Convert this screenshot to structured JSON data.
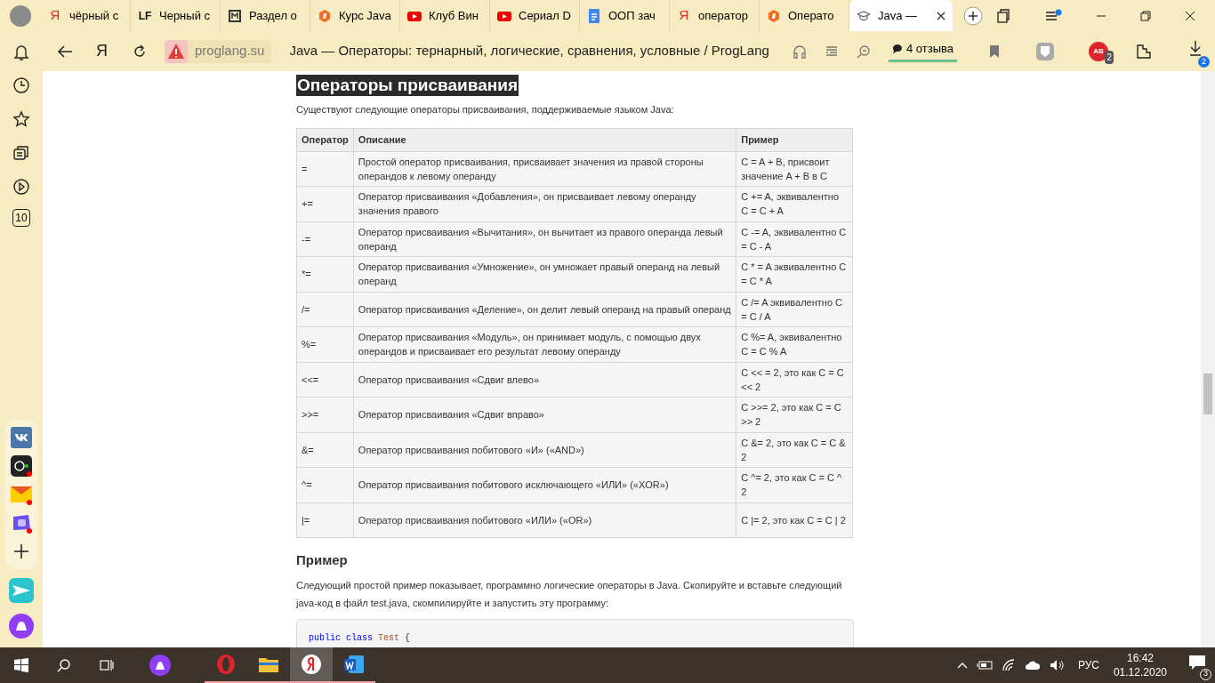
{
  "tabs": [
    {
      "kind": "letter",
      "logo": "Я",
      "title": "чёрный с",
      "selected": false
    },
    {
      "kind": "letter",
      "logo": "LF",
      "title": "Черный с",
      "selected": false
    },
    {
      "kind": "frame",
      "title": "Раздел о",
      "selected": false
    },
    {
      "kind": "hexagon",
      "title": "Курс Java",
      "selected": false
    },
    {
      "kind": "video",
      "title": "Клуб Вин",
      "selected": false
    },
    {
      "kind": "video",
      "title": "Сериал D",
      "selected": false
    },
    {
      "kind": "document",
      "title": "ООП зач",
      "selected": false
    },
    {
      "kind": "letter",
      "logo": "Я",
      "title": "оператор",
      "selected": false
    },
    {
      "kind": "hexagon",
      "title": "Операто",
      "selected": false
    },
    {
      "kind": "cap",
      "title": "Java —",
      "selected": true
    }
  ],
  "address_bar": {
    "home_logo": "Я",
    "adblock_label": "AB",
    "domain": "proglang.su",
    "page_title": "Java — Операторы: тернарный, логические, сравнения, условные / ProgLang",
    "reviews": "4 отзыва",
    "adblock_badge": "2",
    "downloads_badge": "2"
  },
  "sidebar": {
    "counter": "10"
  },
  "article": {
    "heading": "Операторы присваивания",
    "intro": "Существуют следующие операторы присваивания, поддерживаемые языком Java:",
    "table": {
      "columns": [
        "Оператор",
        "Описание",
        "Пример"
      ],
      "rows": [
        [
          "=",
          "Простой оператор присваивания, присваивает значения из правой стороны операндов к левому операнду",
          "C = A + B, присвоит значение A + B в C"
        ],
        [
          "+=",
          "Оператор присваивания «Добавления», он присваивает левому операнду значения правого",
          "C += A, эквивалентно C = C + A"
        ],
        [
          "-=",
          "Оператор присваивания «Вычитания», он вычитает из правого операнда левый операнд",
          "C -= A, эквивалентно C = C - A"
        ],
        [
          "*=",
          "Оператор присваивания «Умножение», он умножает правый операнд на левый операнд",
          "C * = A эквивалентно C = C * A"
        ],
        [
          "/=",
          "Оператор присваивания «Деление», он делит левый операнд на правый операнд",
          "C /= A эквивалентно C = C / A"
        ],
        [
          "%=",
          "Оператор присваивания «Модуль», он принимает модуль, с помощью двух операндов и присваивает его результат левому операнду",
          "C %= A, эквивалентно C = C % A"
        ],
        [
          "<<=",
          "Оператор присваивания «Сдвиг влево»",
          "C << = 2, это как C = C << 2"
        ],
        [
          ">>=",
          "Оператор присваивания «Сдвиг вправо»",
          "C >>= 2, это как C = C >> 2"
        ],
        [
          "&=",
          "Оператор присваивания побитового «И» («AND»)",
          "C &= 2, это как C = C & 2"
        ],
        [
          "^=",
          "Оператор присваивания побитового исключающего «ИЛИ» («XOR»)",
          "C ^= 2, это как C = C ^ 2"
        ],
        [
          "|=",
          "Оператор присваивания побитового «ИЛИ» («OR»)",
          "C |= 2, это как C = C | 2"
        ]
      ]
    },
    "example_heading": "Пример",
    "example_text": "Следующий простой пример показывает, программно логические операторы в Java. Скопируйте и вставьте следующий java-код в файл test.java, скомпилируйте и запустить эту программу:",
    "code": [
      {
        "kind": "keyword",
        "text": "public"
      },
      {
        "kind": "keyword",
        "text": "class"
      },
      {
        "kind": "type",
        "text": "Test"
      },
      {
        "kind": "punct",
        "text": "{"
      }
    ]
  },
  "taskbar": {
    "language": "РУС",
    "time": "16:42",
    "date": "01.12.2020",
    "notifications": "3"
  }
}
